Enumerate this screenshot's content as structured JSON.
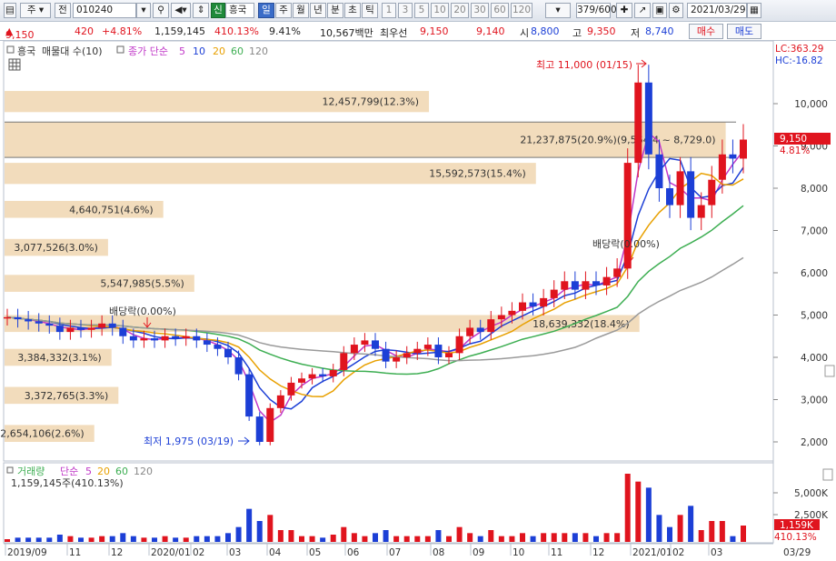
{
  "toolbar": {
    "view_type": "주",
    "previous": "전",
    "stock_code": "010240",
    "credit_badge": "신",
    "stock_name": "흥국",
    "periods": [
      "일",
      "주",
      "월",
      "년",
      "분",
      "초",
      "틱"
    ],
    "active_period": "일",
    "intervals": [
      "1",
      "3",
      "5",
      "10",
      "20",
      "30",
      "60",
      "120"
    ],
    "bar_count": "379/600",
    "date": "2021/03/29"
  },
  "quote": {
    "price": "9,150",
    "change": "420",
    "change_pct": "+4.81%",
    "volume": "1,159,145",
    "volume_ratio": "410.13%",
    "turnover": "9.41%",
    "amount": "10,567백만",
    "priority_label": "최우선",
    "ask": "9,150",
    "bid": "9,140",
    "open_label": "시",
    "open": "8,800",
    "high_label": "고",
    "high": "9,350",
    "low_label": "저",
    "low": "8,740",
    "buy_button": "매수",
    "sell_button": "매도"
  },
  "legend": {
    "stock_name": "흥국",
    "title": "매물대 수(10)",
    "ma_label": "종가 단순",
    "ma_periods": [
      "5",
      "10",
      "20",
      "60",
      "120"
    ],
    "lc": "LC:363.29",
    "hc": "HC:-16.82",
    "volume_title": "거래량",
    "volume_ma_label": "단순",
    "volume_ma_periods": [
      "5",
      "20",
      "60",
      "120"
    ],
    "volume_value": "1,159,145주(410.13%)"
  },
  "colors": {
    "up": "#e0141e",
    "down": "#1c3fd6",
    "ma5": "#c038c8",
    "ma10": "#1c3fd6",
    "ma20": "#e8a000",
    "ma60": "#3dae52",
    "ma120": "#9a9a9a",
    "volume_profile": "#f2dcbc",
    "price_badge": "#e0141e"
  },
  "chart_data": {
    "type": "candlestick",
    "price_axis_ticks": [
      "10,000",
      "9,000",
      "8,000",
      "7,000",
      "6,000",
      "5,000",
      "4,000",
      "3,000",
      "2,000"
    ],
    "volume_axis_ticks": [
      "5,000K",
      "2,500K"
    ],
    "time_axis": [
      "2019/09",
      "11",
      "12",
      "2020/01",
      "02",
      "03",
      "04",
      "05",
      "06",
      "07",
      "08",
      "09",
      "10",
      "11",
      "12",
      "2021/01",
      "02",
      "03",
      "03/29"
    ],
    "current_price_badge": "9,150",
    "current_change_badge": "4.81%",
    "volume_badge": "1,159K",
    "volume_ratio_badge": "410.13%",
    "annotations": {
      "high": "최고 11,000 (01/15)",
      "low": "최저 1,975 (03/19)",
      "dividend_1": "배당락(0.00%)",
      "dividend_2": "배당락(0.00%)"
    },
    "volume_profile": [
      {
        "low": 2000,
        "high": 2400,
        "label": "2,654,106(2.6%)"
      },
      {
        "low": 2900,
        "high": 3300,
        "label": "3,372,765(3.3%)"
      },
      {
        "low": 3800,
        "high": 4200,
        "label": "3,384,332(3.1%)"
      },
      {
        "low": 4600,
        "high": 5000,
        "label": "18,639,332(18.4%)"
      },
      {
        "low": 5550,
        "high": 5950,
        "label": "5,547,985(5.5%)"
      },
      {
        "low": 6400,
        "high": 6800,
        "label": "3,077,526(3.0%)"
      },
      {
        "low": 7300,
        "high": 7700,
        "label": "4,640,751(4.6%)"
      },
      {
        "low": 8100,
        "high": 8600,
        "label": "15,592,573(15.4%)"
      },
      {
        "low": 8729,
        "high": 9564,
        "label": "21,237,875(20.9%)(9,564.4 ~ 8,729.0)"
      },
      {
        "low": 9800,
        "high": 10300,
        "label": "12,457,799(12.3%)"
      }
    ],
    "close": [
      4950,
      4900,
      4850,
      4800,
      4750,
      4600,
      4700,
      4650,
      4700,
      4800,
      4700,
      4500,
      4400,
      4450,
      4400,
      4500,
      4450,
      4500,
      4400,
      4300,
      4200,
      4000,
      3600,
      2600,
      2000,
      2800,
      3100,
      3400,
      3500,
      3600,
      3550,
      3700,
      4100,
      4300,
      4400,
      4200,
      3900,
      4000,
      4100,
      4200,
      4300,
      4000,
      4100,
      4500,
      4700,
      4600,
      4900,
      5000,
      5100,
      5300,
      5200,
      5400,
      5600,
      5800,
      5600,
      5800,
      5700,
      5900,
      6100,
      8600,
      10500,
      8800,
      8000,
      7600,
      8400,
      7300,
      7600,
      8200,
      8800,
      8700,
      9150
    ],
    "volume_note": "volume bars with spikes in 2021/01 and 03"
  }
}
